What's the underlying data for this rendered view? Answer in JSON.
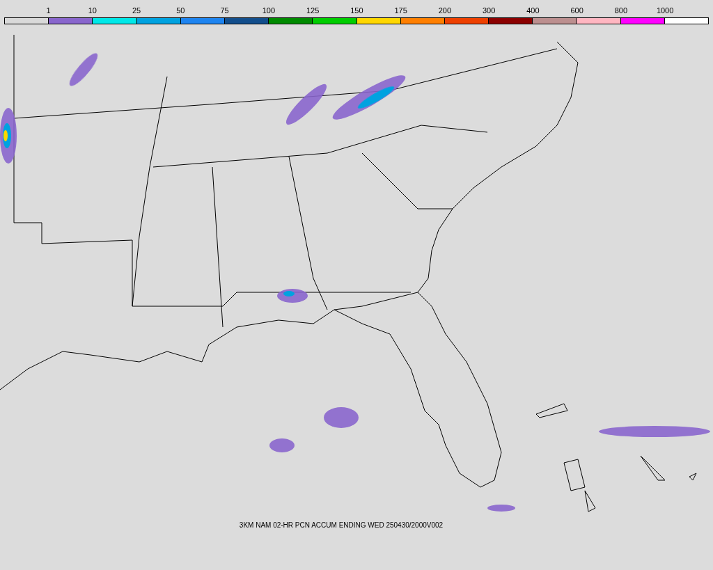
{
  "legend": {
    "labels": [
      "1",
      "10",
      "25",
      "50",
      "75",
      "100",
      "125",
      "150",
      "175",
      "200",
      "300",
      "400",
      "600",
      "800",
      "1000"
    ],
    "segments": [
      {
        "color": "#d9d9d9"
      },
      {
        "color": "#8966cd"
      },
      {
        "color": "#00e8e8"
      },
      {
        "color": "#00a2e0"
      },
      {
        "color": "#1e84f0"
      },
      {
        "color": "#124e8c"
      },
      {
        "color": "#008a00"
      },
      {
        "color": "#00cd00"
      },
      {
        "color": "#ffd700"
      },
      {
        "color": "#ff7f00"
      },
      {
        "color": "#ee4000"
      },
      {
        "color": "#8b0000"
      },
      {
        "color": "#bc8f8f"
      },
      {
        "color": "#ffb6c1"
      },
      {
        "color": "#ff00ff"
      },
      {
        "color": "#ffffff"
      }
    ]
  },
  "caption": "3KM NAM 02-HR PCN ACCUM ENDING WED 250430/2000V002"
}
